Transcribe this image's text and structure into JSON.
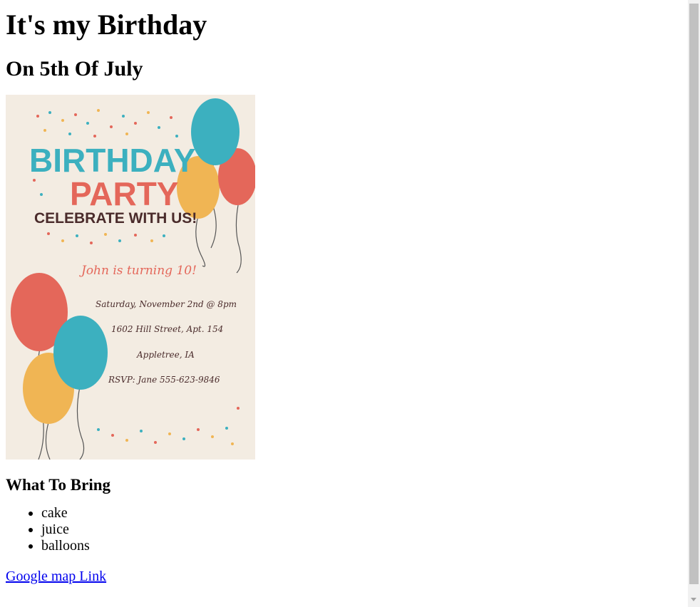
{
  "page": {
    "title": "It's my Birthday",
    "subtitle": "On 5th Of July",
    "bring_heading": "What To Bring",
    "items": [
      "cake",
      "juice",
      "balloons"
    ],
    "map_link": "Google map Link"
  },
  "invitation": {
    "line1": "BIRTHDAY",
    "line2": "PARTY",
    "line3": "CELEBRATE WITH US!",
    "turning": "John is turning 10!",
    "date": "Saturday, November 2nd @ 8pm",
    "address1": "1602 Hill Street, Apt. 154",
    "address2": "Appletree, IA",
    "rsvp": "RSVP: Jane 555-623-9846",
    "colors": {
      "background": "#f3ece2",
      "teal": "#3cb0bf",
      "coral": "#e4675a",
      "orange": "#f0b554",
      "dark": "#4a2b2b"
    }
  }
}
